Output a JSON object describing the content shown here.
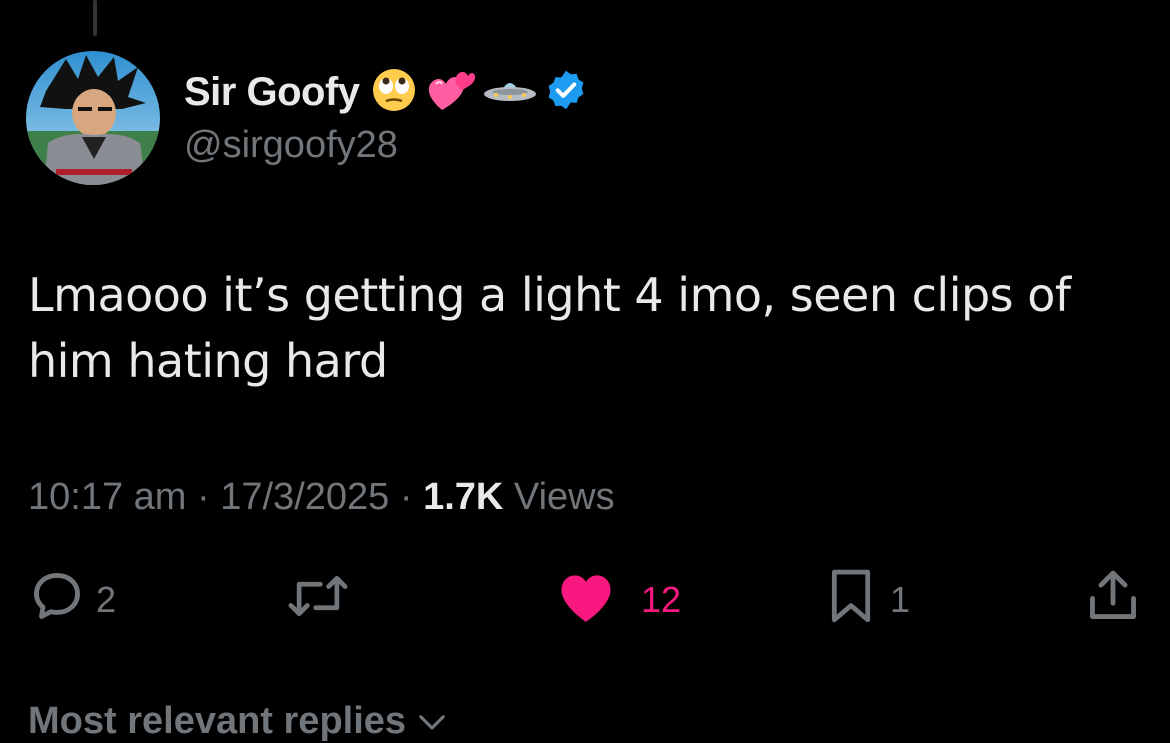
{
  "author": {
    "display_name": "Sir Goofy",
    "handle": "@sirgoofy28",
    "badges": [
      "rolling-eyes-emoji",
      "two-hearts-emoji",
      "flying-saucer-emoji",
      "verified-badge-icon"
    ],
    "verified_color": "#1d9bf0"
  },
  "tweet": {
    "text": "Lmaooo it’s getting a light 4 imo, seen clips of him hating hard",
    "time": "10:17 am",
    "date": "17/3/2025",
    "separator": "·",
    "views_count": "1.7K",
    "views_label": "Views"
  },
  "actions": {
    "reply_count": "2",
    "retweet_count": "",
    "like_count": "12",
    "bookmark_count": "1"
  },
  "replies_header": {
    "label": "Most relevant replies"
  },
  "colors": {
    "background": "#000000",
    "text_primary": "#e7e9ea",
    "text_secondary": "#71767b",
    "like_pink": "#f91880"
  }
}
